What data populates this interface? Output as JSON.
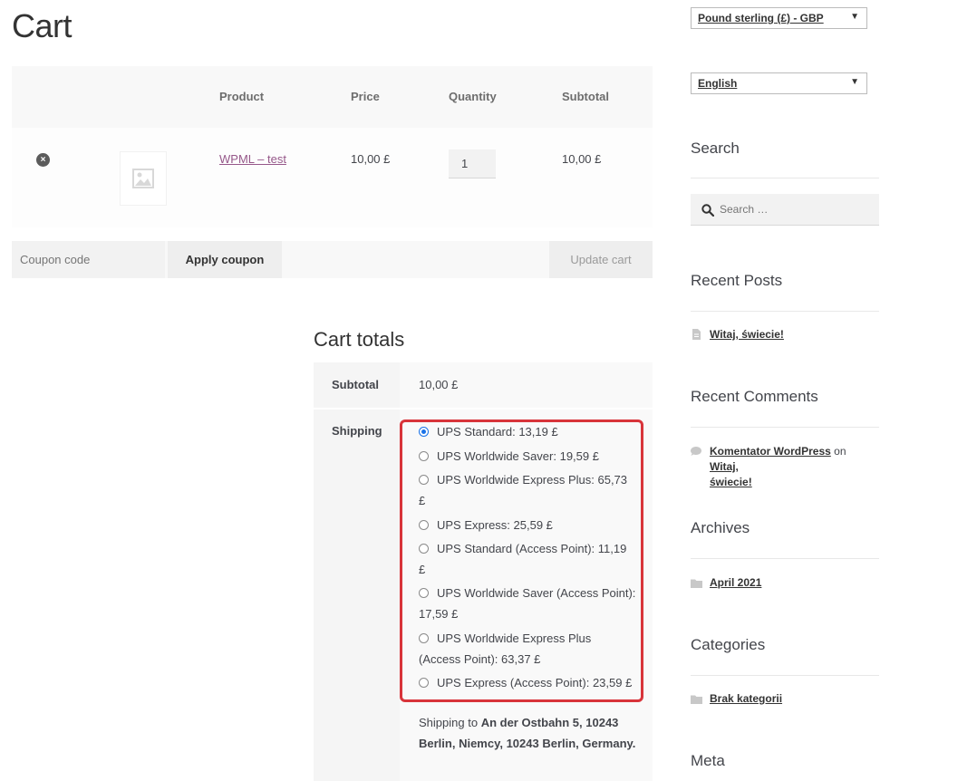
{
  "page": {
    "title": "Cart"
  },
  "cart_table": {
    "headers": {
      "product": "Product",
      "price": "Price",
      "quantity": "Quantity",
      "subtotal": "Subtotal"
    },
    "items": [
      {
        "name": "WPML – test",
        "price": "10,00 £",
        "quantity": "1",
        "subtotal": "10,00 £"
      }
    ]
  },
  "actions": {
    "coupon_placeholder": "Coupon code",
    "apply_label": "Apply coupon",
    "update_label": "Update cart"
  },
  "totals": {
    "title": "Cart totals",
    "subtotal_label": "Subtotal",
    "subtotal_value": "10,00 £",
    "shipping_label": "Shipping",
    "shipping_options": [
      {
        "label": "UPS Standard: 13,19 £",
        "selected": true
      },
      {
        "label": "UPS Worldwide Saver: 19,59 £",
        "selected": false
      },
      {
        "label": "UPS Worldwide Express Plus: 65,73 £",
        "selected": false
      },
      {
        "label": "UPS Express: 25,59 £",
        "selected": false
      },
      {
        "label": "UPS Standard (Access Point): 11,19 £",
        "selected": false
      },
      {
        "label": "UPS Worldwide Saver (Access Point): 17,59 £",
        "selected": false
      },
      {
        "label": "UPS Worldwide Express Plus (Access Point): 63,37 £",
        "selected": false
      },
      {
        "label": "UPS Express (Access Point): 23,59 £",
        "selected": false
      }
    ],
    "shipping_to_prefix": "Shipping to",
    "shipping_to_address": "An der Ostbahn 5, 10243 Berlin, Niemcy, 10243 Berlin, Germany."
  },
  "sidebar": {
    "currency_select": "Pound sterling (£) - GBP",
    "language_select": "English",
    "search": {
      "title": "Search",
      "placeholder": "Search …"
    },
    "recent_posts": {
      "title": "Recent Posts",
      "items": [
        "Witaj, świecie!"
      ]
    },
    "recent_comments": {
      "title": "Recent Comments",
      "author": "Komentator WordPress",
      "connector": "on",
      "post_line1": "Witaj,",
      "post_line2": "świecie!"
    },
    "archives": {
      "title": "Archives",
      "items": [
        "April 2021"
      ]
    },
    "categories": {
      "title": "Categories",
      "items": [
        "Brak kategorii"
      ]
    },
    "meta": {
      "title": "Meta"
    }
  },
  "colors": {
    "link": "#96588a",
    "highlight_border": "#d8343a",
    "radio_selected": "#1a73e8"
  }
}
